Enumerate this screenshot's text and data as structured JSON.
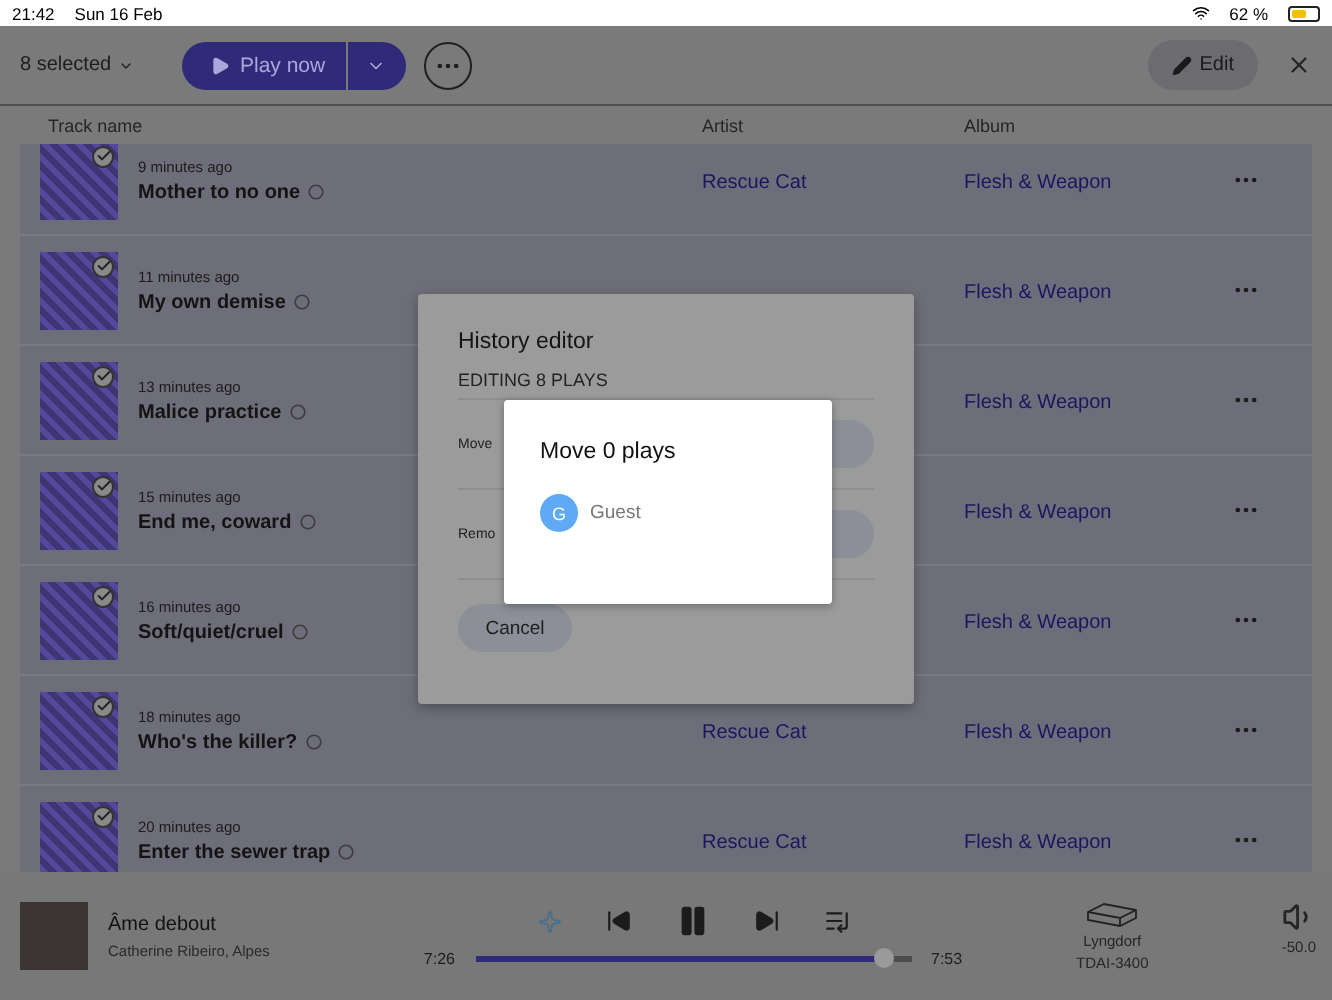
{
  "status_bar": {
    "time": "21:42",
    "date": "Sun 16 Feb",
    "battery": "62 %"
  },
  "toolbar": {
    "selection": "8 selected",
    "play_button": "Play now",
    "edit_button": "Edit"
  },
  "table": {
    "columns": [
      "Track name",
      "Artist",
      "Album"
    ],
    "rows": [
      {
        "time": "9 minutes ago",
        "title": "Mother to no one",
        "artist": "Rescue Cat",
        "album": "Flesh & Weapon",
        "checked": true
      },
      {
        "time": "11 minutes ago",
        "title": "My own demise",
        "album": "Flesh & Weapon",
        "checked": true
      },
      {
        "time": "13 minutes ago",
        "title": "Malice practice",
        "album": "Flesh & Weapon",
        "checked": true
      },
      {
        "time": "15 minutes ago",
        "title": "End me, coward",
        "album": "Flesh & Weapon",
        "checked": true
      },
      {
        "time": "16 minutes ago",
        "title": "Soft/quiet/cruel",
        "album": "Flesh & Weapon",
        "checked": true
      },
      {
        "time": "18 minutes ago",
        "title": "Who's the killer?",
        "artist": "Rescue Cat",
        "album": "Flesh & Weapon",
        "checked": true
      },
      {
        "time": "20 minutes ago",
        "title": "Enter the sewer trap",
        "artist": "Rescue Cat",
        "album": "Flesh & Weapon",
        "checked": true
      }
    ]
  },
  "player": {
    "title": "Âme debout",
    "subtitle": "Catherine Ribeiro, Alpes",
    "elapsed": "7:26",
    "total": "7:53",
    "level": 0.94,
    "device": [
      "Lyngdorf",
      "TDAI-3400"
    ],
    "volume": "-50.0"
  },
  "history_editor": {
    "title": "History editor",
    "subtitle": "EDITING 8 PLAYS",
    "options": [
      "Move",
      "Remo"
    ],
    "cancel": "Cancel"
  },
  "move_dialog": {
    "title": "Move 0 plays",
    "users": [
      {
        "initial": "G",
        "name": "Guest"
      }
    ]
  }
}
